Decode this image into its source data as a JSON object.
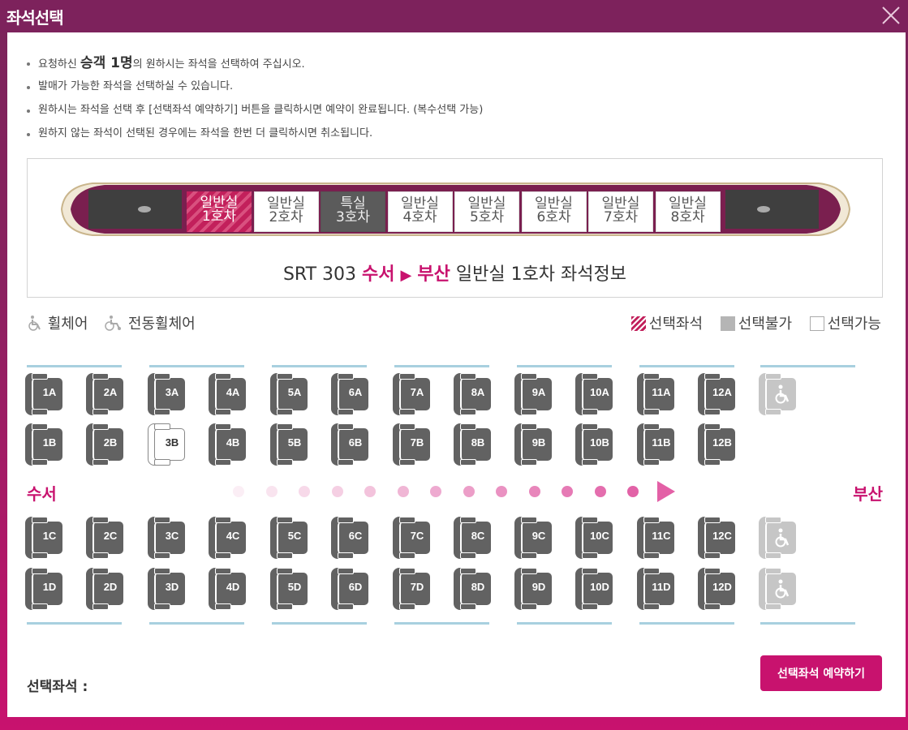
{
  "window": {
    "title": "좌석선택"
  },
  "notices": {
    "line1_pre": "요청하신 ",
    "line1_strong": "승객 1명",
    "line1_post": "의 원하시는 좌석을 선택하여 주십시오.",
    "line2": "발매가 가능한 좌석을 선택하실 수 있습니다.",
    "line3": "원하시는 좌석을 선택 후 [선택좌석 예약하기] 버튼을 클릭하시면 예약이 완료됩니다. (복수선택 가능)",
    "line4": "원하지 않는 좌석이 선택된 경우에는 좌석을 한번 더 클릭하시면 취소됩니다."
  },
  "cars": [
    {
      "class": "일반실",
      "num": "1호차",
      "state": "current"
    },
    {
      "class": "일반실",
      "num": "2호차",
      "state": "normal"
    },
    {
      "class": "특실",
      "num": "3호차",
      "state": "special"
    },
    {
      "class": "일반실",
      "num": "4호차",
      "state": "normal"
    },
    {
      "class": "일반실",
      "num": "5호차",
      "state": "normal"
    },
    {
      "class": "일반실",
      "num": "6호차",
      "state": "normal"
    },
    {
      "class": "일반실",
      "num": "7호차",
      "state": "normal"
    },
    {
      "class": "일반실",
      "num": "8호차",
      "state": "normal"
    }
  ],
  "car_info": {
    "train": "SRT 303",
    "from": "수서",
    "arrow": "▶",
    "to": "부산",
    "suffix": "일반실 1호차 좌석정보"
  },
  "legend": {
    "wheelchair": "휠체어",
    "electric_wheelchair": "전동휠체어",
    "selected": "선택좌석",
    "unavailable": "선택불가",
    "available": "선택가능"
  },
  "direction": {
    "from": "수서",
    "to": "부산"
  },
  "seat_rows": {
    "A": {
      "seats": [
        "1A",
        "2A",
        "3A",
        "4A",
        "5A",
        "6A",
        "7A",
        "8A",
        "9A",
        "10A",
        "11A",
        "12A"
      ],
      "wheelchair": true
    },
    "B": {
      "seats": [
        "1B",
        "2B",
        "3B",
        "4B",
        "5B",
        "6B",
        "7B",
        "8B",
        "9B",
        "10B",
        "11B",
        "12B"
      ],
      "wheelchair": false
    },
    "C": {
      "seats": [
        "1C",
        "2C",
        "3C",
        "4C",
        "5C",
        "6C",
        "7C",
        "8C",
        "9C",
        "10C",
        "11C",
        "12C"
      ],
      "wheelchair": true
    },
    "D": {
      "seats": [
        "1D",
        "2D",
        "3D",
        "4D",
        "5D",
        "6D",
        "7D",
        "8D",
        "9D",
        "10D",
        "11D",
        "12D"
      ],
      "wheelchair": true
    }
  },
  "available_seats": [
    "3B"
  ],
  "footer": {
    "selected_label": "선택좌석 :",
    "reserve_button": "선택좌석 예약하기"
  }
}
